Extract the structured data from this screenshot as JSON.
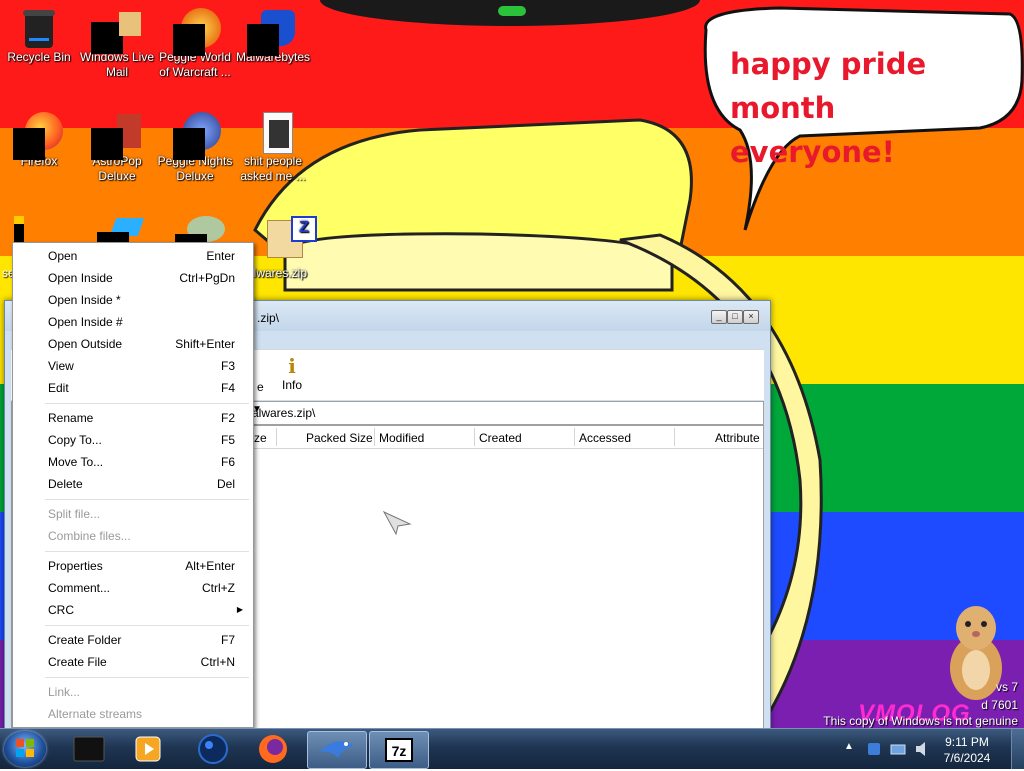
{
  "desktop": {
    "speech_bubble": [
      "happy pride month",
      "everyone!"
    ],
    "icons": [
      {
        "label": "Recycle Bin"
      },
      {
        "label": "Windows Live Mail"
      },
      {
        "label": "Peggle World of Warcraft ..."
      },
      {
        "label": "Malwarebytes"
      },
      {
        "label": "Firefox"
      },
      {
        "label": "AstroPop Deluxe"
      },
      {
        "label": "Peggle Nights Deluxe"
      },
      {
        "label": "shit people asked me ..."
      },
      {
        "label": "se"
      },
      {
        "label": "alwares.zip"
      }
    ],
    "watermark": {
      "line1": "vs 7",
      "line2": "d 7601",
      "line3": "This copy of Windows is not genuine"
    },
    "vm_logo": "VMOLOG"
  },
  "window": {
    "title": ".zip\\",
    "toolbar": {
      "partial_label": "e",
      "info_label": "Info"
    },
    "address": "alwares.zip\\",
    "columns": [
      "ze",
      "Packed Size",
      "Modified",
      "Created",
      "Accessed",
      "Attribute"
    ]
  },
  "context_menu": {
    "items": [
      {
        "label": "Open",
        "shortcut": "Enter",
        "disabled": false
      },
      {
        "label": "Open Inside",
        "shortcut": "Ctrl+PgDn",
        "disabled": false
      },
      {
        "label": "Open Inside *",
        "shortcut": "",
        "disabled": false
      },
      {
        "label": "Open Inside #",
        "shortcut": "",
        "disabled": false
      },
      {
        "label": "Open Outside",
        "shortcut": "Shift+Enter",
        "disabled": false
      },
      {
        "label": "View",
        "shortcut": "F3",
        "disabled": false
      },
      {
        "label": "Edit",
        "shortcut": "F4",
        "disabled": false
      },
      {
        "label": "Rename",
        "shortcut": "F2",
        "disabled": false
      },
      {
        "label": "Copy To...",
        "shortcut": "F5",
        "disabled": false
      },
      {
        "label": "Move To...",
        "shortcut": "F6",
        "disabled": false
      },
      {
        "label": "Delete",
        "shortcut": "Del",
        "disabled": false
      },
      {
        "label": "Split file...",
        "shortcut": "",
        "disabled": true
      },
      {
        "label": "Combine files...",
        "shortcut": "",
        "disabled": true
      },
      {
        "label": "Properties",
        "shortcut": "Alt+Enter",
        "disabled": false
      },
      {
        "label": "Comment...",
        "shortcut": "Ctrl+Z",
        "disabled": false
      },
      {
        "label": "CRC",
        "shortcut": "",
        "disabled": false,
        "submenu": true
      },
      {
        "label": "Create Folder",
        "shortcut": "F7",
        "disabled": false
      },
      {
        "label": "Create File",
        "shortcut": "Ctrl+N",
        "disabled": false
      },
      {
        "label": "Link...",
        "shortcut": "",
        "disabled": true
      },
      {
        "label": "Alternate streams",
        "shortcut": "",
        "disabled": true
      }
    ]
  },
  "taskbar": {
    "time": "9:11 PM",
    "date": "7/6/2024",
    "pinned": [
      "start-orb-icon",
      "dark-box-icon",
      "media-player-icon",
      "globe-icon",
      "firefox-icon",
      "bird-app-icon",
      "7zip-icon"
    ]
  },
  "colors": {
    "flag_red": "#ff1a1a",
    "flag_orange": "#ff7f00",
    "flag_yellow": "#ffe600",
    "flag_green": "#00a83a",
    "flag_blue": "#1e4bff",
    "flag_purple": "#7a1fb0",
    "bubble_text": "#e8192c"
  }
}
